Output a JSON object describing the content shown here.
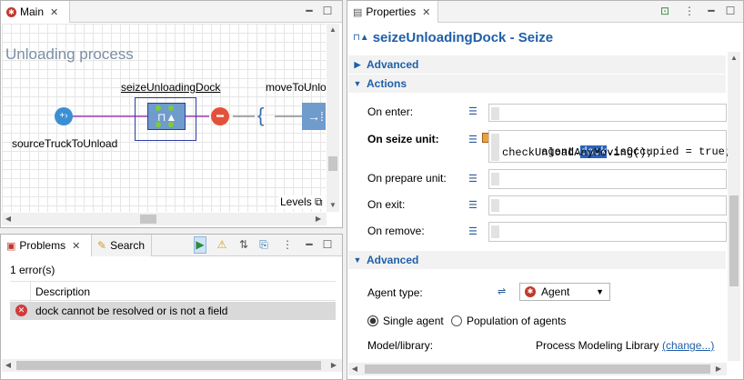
{
  "main_view": {
    "tab_label": "Main",
    "diagram_title": "Unloading process",
    "blocks": {
      "source": "sourceTruckToUnload",
      "seize": "seizeUnloadingDock",
      "move": "moveToUnlo"
    },
    "levels_label": "Levels"
  },
  "problems_view": {
    "tabs": [
      "Problems",
      "Search"
    ],
    "summary": "1 error(s)",
    "columns": [
      "Description"
    ],
    "rows": [
      {
        "description": "dock cannot be resolved or is not a field"
      }
    ]
  },
  "properties": {
    "tab_label": "Properties",
    "element_title": "seizeUnloadingDock - Seize",
    "sections": {
      "advanced_top": "Advanced",
      "actions": "Actions",
      "advanced_bottom": "Advanced"
    },
    "fields": {
      "on_enter": "On enter:",
      "on_seize_unit": "On seize unit:",
      "on_prepare_unit": "On prepare unit:",
      "on_exit": "On exit:",
      "on_remove": "On remove:"
    },
    "code": {
      "line1_pre": "agent.",
      "line1_highlight": "dock",
      "line1_post": ".isOccupied = true;",
      "line2": "checkUnloadAnyMoving();"
    },
    "agent_type_label": "Agent type:",
    "agent_type_value": "Agent",
    "radio": {
      "single": "Single agent",
      "population": "Population of agents",
      "selected": "single"
    },
    "model_library_label": "Model/library:",
    "model_library_value": "Process Modeling Library",
    "change_link": "(change...)"
  }
}
